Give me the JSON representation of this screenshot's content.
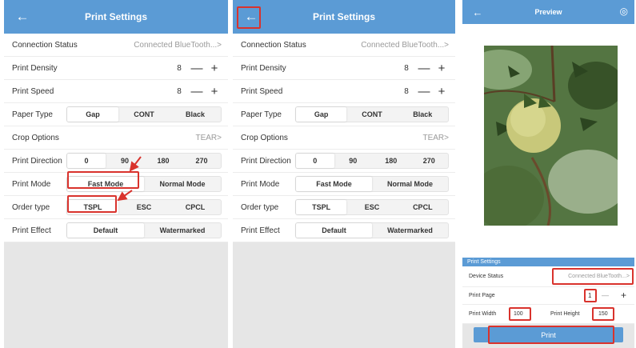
{
  "header": {
    "back_icon": "←",
    "title": "Print Settings"
  },
  "settings": {
    "connection": {
      "label": "Connection Status",
      "value": "Connected BlueTooth...",
      "chevron": ">"
    },
    "density": {
      "label": "Print Density",
      "value": "8",
      "minus": "—",
      "plus": "+"
    },
    "speed": {
      "label": "Print Speed",
      "value": "8",
      "minus": "—",
      "plus": "+"
    },
    "paper": {
      "label": "Paper Type",
      "options": [
        "Gap",
        "CONT",
        "Black"
      ],
      "selected": 0
    },
    "crop": {
      "label": "Crop Options",
      "value": "TEAR",
      "chevron": ">"
    },
    "direction": {
      "label": "Print Direction",
      "options": [
        "0",
        "90",
        "180",
        "270"
      ],
      "selected": 0
    },
    "mode": {
      "label": "Print Mode",
      "options": [
        "Fast Mode",
        "Normal Mode"
      ],
      "selected": 0
    },
    "order": {
      "label": "Order type",
      "options": [
        "TSPL",
        "ESC",
        "CPCL"
      ],
      "selected": 0
    },
    "effect": {
      "label": "Print Effect",
      "options": [
        "Default",
        "Watermarked"
      ],
      "selected": 0
    }
  },
  "preview": {
    "header": {
      "back_icon": "←",
      "title": "Preview",
      "settings_icon": "◎"
    },
    "section_title": "Print Settings",
    "device_status": {
      "label": "Device Status",
      "value": "Connected BlueTooth...",
      "chevron": ">"
    },
    "print_page": {
      "label": "Print Page",
      "value": "1",
      "minus": "—",
      "plus": "+"
    },
    "print_width": {
      "label": "Print Width",
      "value": "100"
    },
    "print_height": {
      "label": "Print Height",
      "value": "150"
    },
    "print_button": "Print"
  },
  "colors": {
    "header": "#5b9bd5",
    "highlight": "#d9332d",
    "background": "#e6e6e6"
  }
}
